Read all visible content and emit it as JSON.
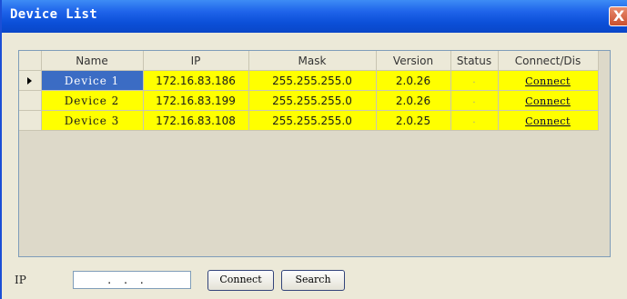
{
  "window": {
    "title": "Device List",
    "close_label": "X"
  },
  "table": {
    "columns": [
      "Name",
      "IP",
      "Mask",
      "Version",
      "Status",
      "Connect/Dis"
    ],
    "rows": [
      {
        "name": "Device 1",
        "ip": "172.16.83.186",
        "mask": "255.255.255.0",
        "version": "2.0.26",
        "status": ".",
        "action": "Connect"
      },
      {
        "name": "Device 2",
        "ip": "172.16.83.199",
        "mask": "255.255.255.0",
        "version": "2.0.26",
        "status": ".",
        "action": "Connect"
      },
      {
        "name": "Device 3",
        "ip": "172.16.83.108",
        "mask": "255.255.255.0",
        "version": "2.0.25",
        "status": ".",
        "action": "Connect"
      }
    ],
    "selected_row": 0,
    "row_highlight_color": "#ffff00",
    "selected_cell_color": "#3b6cc4"
  },
  "footer": {
    "ip_label": "IP",
    "ip_value": "...",
    "connect_label": "Connect",
    "search_label": "Search"
  },
  "icons": {
    "current_row": "row-pointer-icon",
    "close": "close-icon"
  }
}
